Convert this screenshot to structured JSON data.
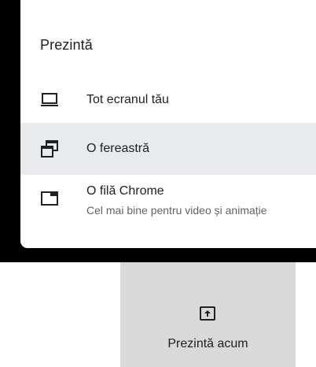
{
  "menu": {
    "title": "Prezintă",
    "items": [
      {
        "label": "Tot ecranul tău",
        "icon": "laptop-icon"
      },
      {
        "label": "O fereastră",
        "icon": "window-icon",
        "highlighted": true
      },
      {
        "label": "O filă Chrome",
        "sublabel": "Cel mai bine pentru video și animație",
        "icon": "tab-icon"
      }
    ]
  },
  "present_button": {
    "label": "Prezintă acum",
    "icon": "present-to-all-icon"
  },
  "colors": {
    "backdrop": "#000000",
    "highlight": "#e8eaed",
    "button_bg": "#d9d9d9",
    "text_primary": "#202124",
    "text_secondary": "#5f6368"
  }
}
